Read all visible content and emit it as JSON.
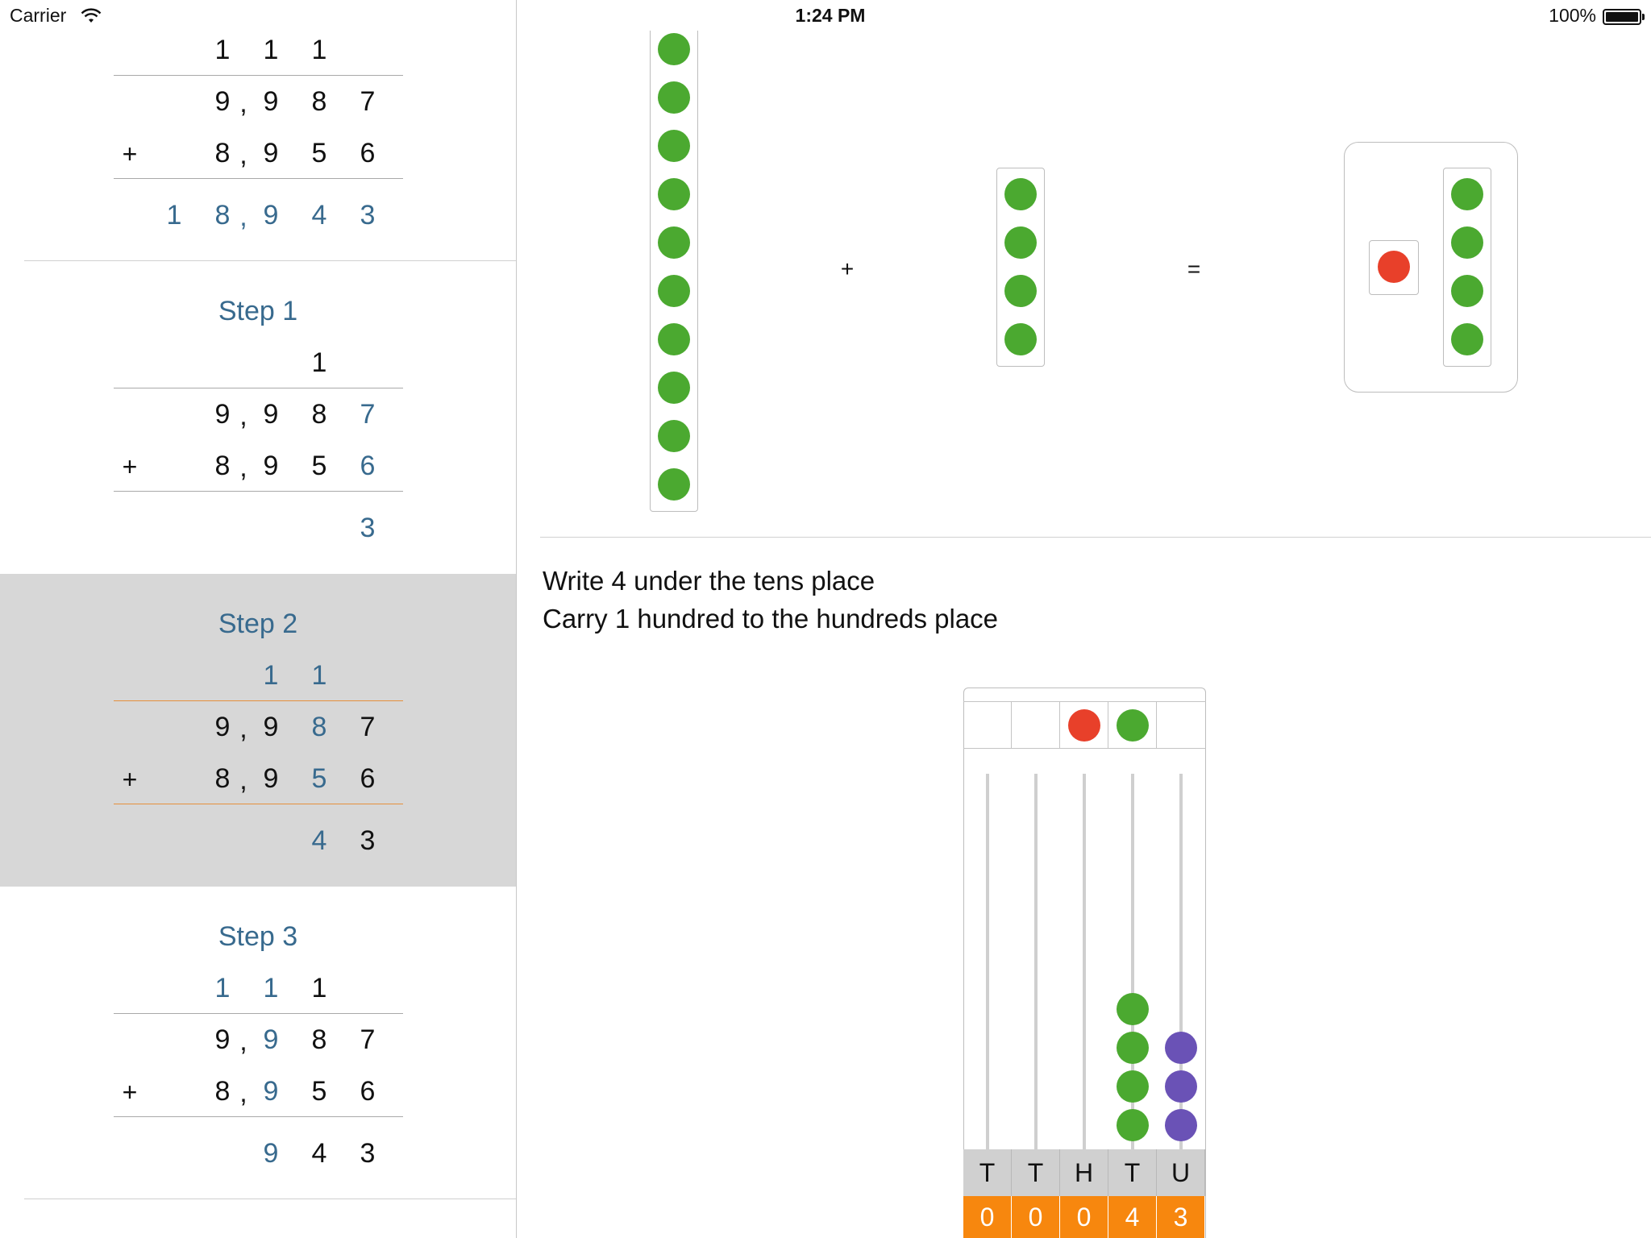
{
  "status_bar": {
    "carrier": "Carrier",
    "time": "1:24 PM",
    "battery": "100%"
  },
  "sidebar": {
    "problem": {
      "carry": [
        "1",
        "1",
        "1"
      ],
      "addend1": [
        "9",
        ",",
        "9",
        "8",
        "7"
      ],
      "addend2": [
        "8",
        ",",
        "9",
        "5",
        "6"
      ],
      "operator": "+",
      "sum": [
        "1",
        "8",
        ",",
        "9",
        "4",
        "3"
      ]
    },
    "steps": [
      {
        "title": "Step 1",
        "carry": [
          "1"
        ],
        "addend1": [
          "9",
          ",",
          "9",
          "8",
          "7"
        ],
        "addend2": [
          "8",
          ",",
          "9",
          "5",
          "6"
        ],
        "operator": "+",
        "result": [
          "3"
        ]
      },
      {
        "title": "Step 2",
        "carry": [
          "1",
          "1"
        ],
        "addend1": [
          "9",
          ",",
          "9",
          "8",
          "7"
        ],
        "addend2": [
          "8",
          ",",
          "9",
          "5",
          "6"
        ],
        "operator": "+",
        "result": [
          "4",
          "3"
        ],
        "selected": true
      },
      {
        "title": "Step 3",
        "carry": [
          "1",
          "1",
          "1"
        ],
        "addend1": [
          "9",
          ",",
          "9",
          "8",
          "7"
        ],
        "addend2": [
          "8",
          ",",
          "9",
          "5",
          "6"
        ],
        "operator": "+",
        "result": [
          "9",
          "4",
          "3"
        ]
      }
    ]
  },
  "visual": {
    "plus": "+",
    "equals": "=",
    "tube1_beads": 10,
    "tube2_beads": 4,
    "result_carry_beads": 1,
    "result_tube_beads": 4
  },
  "instructions": {
    "line1": "Write 4 under the tens place",
    "line2": "Carry 1 hundred to the hundreds place"
  },
  "abacus": {
    "columns": [
      "T",
      "T",
      "H",
      "T",
      "U"
    ],
    "values": [
      "0",
      "0",
      "0",
      "4",
      "3"
    ],
    "tray": [
      "",
      "",
      "red",
      "green",
      ""
    ],
    "bead_counts": [
      0,
      0,
      0,
      4,
      3
    ]
  },
  "colors": {
    "accent_text": "#386a8e",
    "green_bead": "#4ba930",
    "red_bead": "#e8402a",
    "purple_bead": "#6a52b6",
    "value_bg": "#f7870e"
  }
}
